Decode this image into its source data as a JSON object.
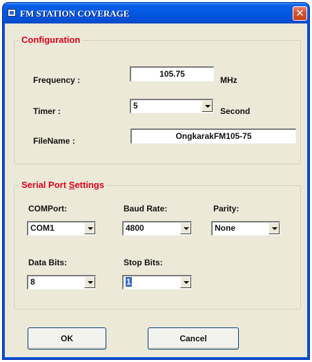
{
  "window": {
    "title": "FM STATION COVERAGE",
    "close_label": "✕"
  },
  "configuration": {
    "legend": "Configuration",
    "frequency": {
      "label": "Frequency :",
      "value": "105.75",
      "unit": "MHz"
    },
    "timer": {
      "label": "Timer :",
      "value": "5",
      "unit": "Second"
    },
    "filename": {
      "label": "FileName :",
      "value": "OngkarakFM105-75"
    }
  },
  "serial": {
    "legend_prefix": "Serial Port ",
    "legend_underlined": "S",
    "legend_suffix": "ettings",
    "comport": {
      "label": "COMPort:",
      "value": "COM1"
    },
    "baud": {
      "label": "Baud Rate:",
      "value": "4800"
    },
    "parity": {
      "label": "Parity:",
      "value": "None"
    },
    "databits": {
      "label": "Data Bits:",
      "value": "8"
    },
    "stopbits": {
      "label": "Stop Bits:",
      "value": "1"
    }
  },
  "buttons": {
    "ok": "OK",
    "cancel": "Cancel"
  },
  "icons": {
    "title": "app-window-icon",
    "close": "close-icon",
    "dropdown": "chevron-down-icon"
  },
  "colors": {
    "titlebar": "#0458e0",
    "legend": "#e0001a",
    "window_bg": "#ece9d8",
    "close": "#d8532f"
  }
}
